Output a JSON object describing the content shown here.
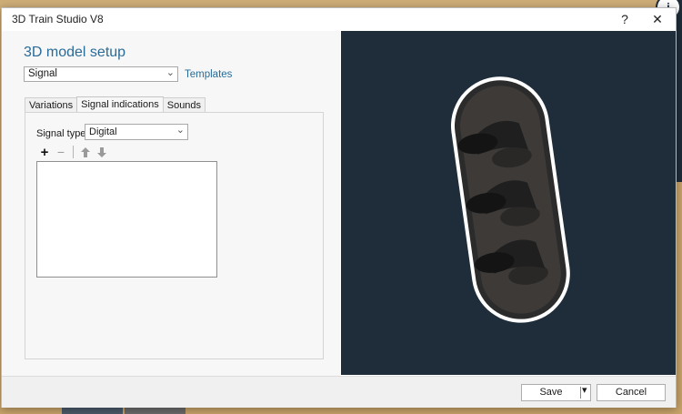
{
  "window": {
    "title": "3D Train Studio V8",
    "help_glyph": "?",
    "close_glyph": "✕"
  },
  "setup": {
    "heading": "3D model setup",
    "model_type": "Signal",
    "templates_link": "Templates"
  },
  "tabs": [
    {
      "label": "Variations",
      "active": false
    },
    {
      "label": "Signal indications",
      "active": true
    },
    {
      "label": "Sounds",
      "active": false
    }
  ],
  "signal_indications": {
    "signal_type_label": "Signal type:",
    "signal_type_value": "Digital",
    "add_glyph": "+",
    "remove_glyph": "−",
    "move_up_glyph": "🡑",
    "move_down_glyph": "🡓",
    "items": []
  },
  "preview": {
    "background_color": "#1f2d3a",
    "model_icon": "signal-3-lights"
  },
  "footer": {
    "save_label": "Save",
    "dropdown_glyph": "▾",
    "cancel_label": "Cancel"
  },
  "colors": {
    "accent": "#2a6b97",
    "viewport": "#1f2d3a"
  },
  "background_app": {
    "badge_glyph": "i"
  }
}
